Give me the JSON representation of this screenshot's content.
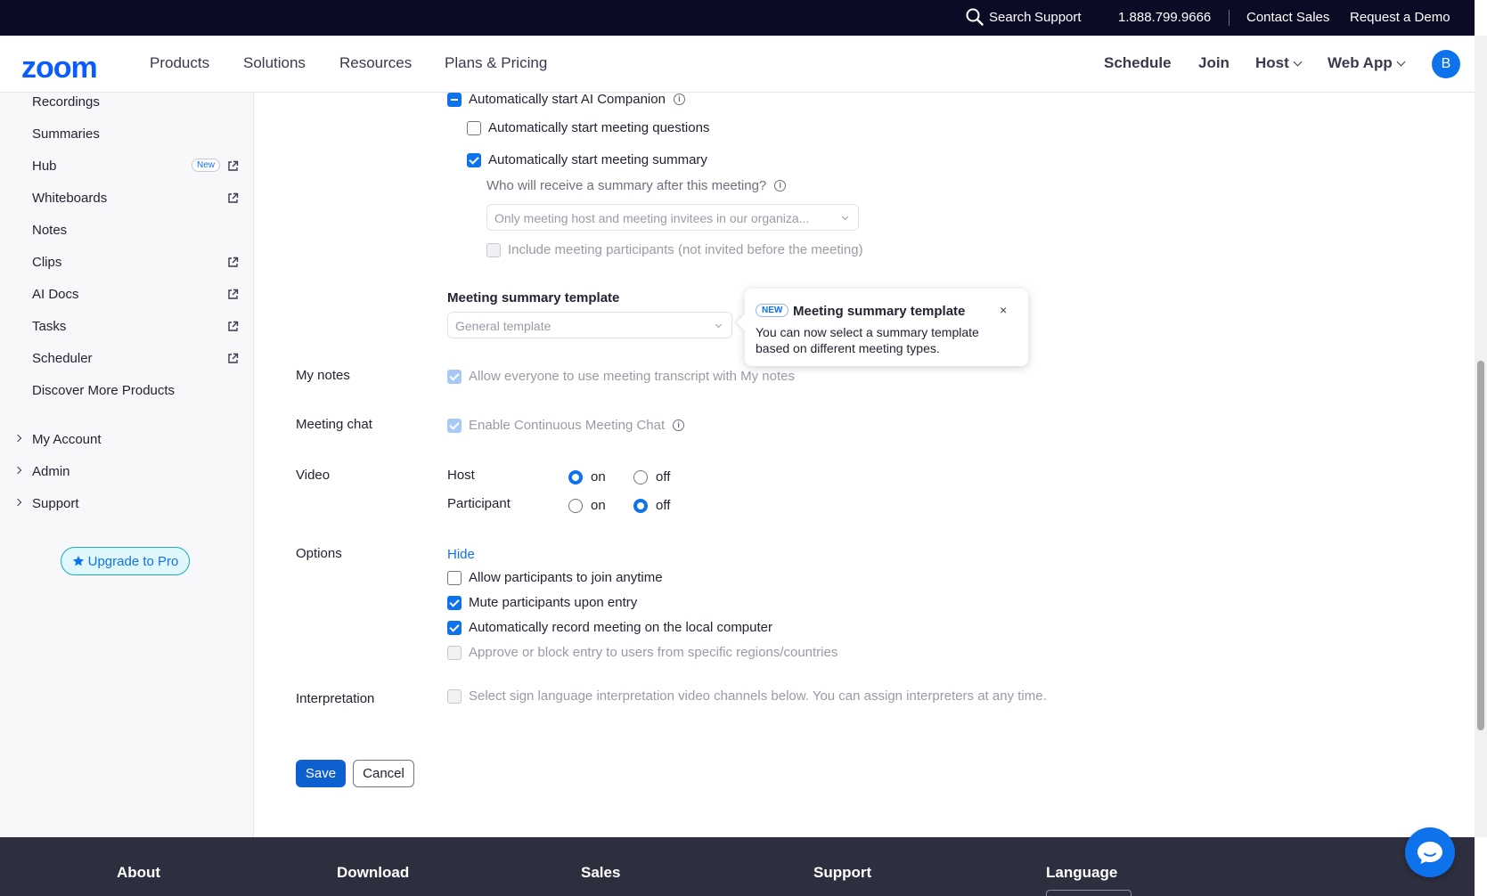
{
  "topbar": {
    "search": "Search",
    "support": "Support",
    "phone": "1.888.799.9666",
    "contact_sales": "Contact Sales",
    "request_demo": "Request a Demo"
  },
  "nav": {
    "logo": "zoom",
    "products": "Products",
    "solutions": "Solutions",
    "resources": "Resources",
    "plans": "Plans & Pricing",
    "schedule": "Schedule",
    "join": "Join",
    "host": "Host",
    "web_app": "Web App",
    "avatar_initial": "B"
  },
  "sidebar": {
    "items": [
      {
        "label": "Recordings"
      },
      {
        "label": "Summaries"
      },
      {
        "label": "Hub",
        "badge": "New"
      },
      {
        "label": "Whiteboards"
      },
      {
        "label": "Notes"
      },
      {
        "label": "Clips"
      },
      {
        "label": "AI Docs"
      },
      {
        "label": "Tasks"
      },
      {
        "label": "Scheduler"
      },
      {
        "label": "Discover More Products"
      }
    ],
    "expandables": [
      "My Account",
      "Admin",
      "Support"
    ],
    "upgrade": "Upgrade to Pro"
  },
  "content": {
    "ai_companion": "Automatically start AI Companion",
    "meeting_questions": "Automatically start meeting questions",
    "meeting_summary": "Automatically start meeting summary",
    "who_receive": "Who will receive a summary after this meeting?",
    "recipients_select": "Only meeting host and meeting invitees in our organiza...",
    "include_participants": "Include meeting participants (not invited before the meeting)",
    "template_title": "Meeting summary template",
    "template_select": "General template",
    "my_notes_label": "My notes",
    "my_notes_option": "Allow everyone to use meeting transcript with My notes",
    "chat_label": "Meeting chat",
    "chat_option": "Enable Continuous Meeting Chat",
    "video_label": "Video",
    "host_label": "Host",
    "participant_label": "Participant",
    "on": "on",
    "off": "off",
    "options_label": "Options",
    "hide": "Hide",
    "opt_join_anytime": "Allow participants to join anytime",
    "opt_mute": "Mute participants upon entry",
    "opt_record": "Automatically record meeting on the local computer",
    "opt_regions": "Approve or block entry to users from specific regions/countries",
    "interpretation_label": "Interpretation",
    "interpretation_option": "Select sign language interpretation video channels below. You can assign interpreters at any time.",
    "save": "Save",
    "cancel": "Cancel"
  },
  "popover": {
    "badge": "NEW",
    "title": "Meeting summary template",
    "close": "×",
    "body": "You can now select a summary template based on different meeting types."
  },
  "footer": {
    "about": "About",
    "download": "Download",
    "sales": "Sales",
    "support": "Support",
    "language": "Language"
  },
  "colors": {
    "accent": "#0e72ed",
    "topbar": "#0b0b26",
    "footer": "#2d2f3f"
  }
}
